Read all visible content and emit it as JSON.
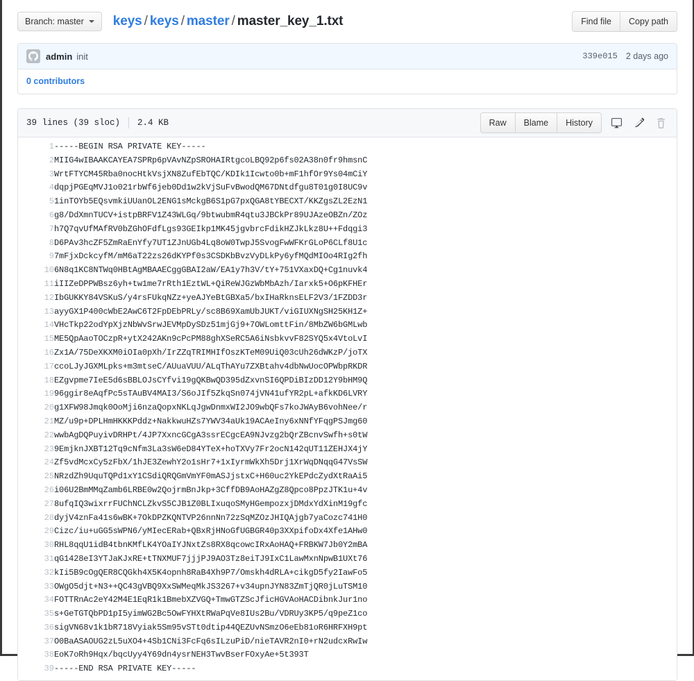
{
  "header": {
    "branch_button": {
      "label": "Branch: master",
      "icon": "chevron-down-icon"
    },
    "breadcrumb": {
      "parts": [
        "keys",
        "keys",
        "master"
      ],
      "separator": "/",
      "filename": "master_key_1.txt"
    },
    "actions": [
      {
        "label": "Find file",
        "name": "find-file-button"
      },
      {
        "label": "Copy path",
        "name": "copy-path-button"
      }
    ]
  },
  "commit": {
    "avatar_icon": "github-mark-icon",
    "author": "admin",
    "message": "init",
    "sha": "339e015",
    "time": "2 days ago",
    "contributors": "0 contributors"
  },
  "file": {
    "lines_text": "39 lines (39 sloc)",
    "size_text": "2.4 KB",
    "buttons": [
      {
        "label": "Raw",
        "name": "raw-button"
      },
      {
        "label": "Blame",
        "name": "blame-button"
      },
      {
        "label": "History",
        "name": "history-button"
      }
    ],
    "icons": [
      {
        "name": "desktop-icon",
        "title": "Open in desktop"
      },
      {
        "name": "pencil-icon",
        "title": "Edit this file"
      },
      {
        "name": "trash-icon",
        "title": "Delete this file"
      }
    ],
    "lines": [
      "-----BEGIN RSA PRIVATE KEY-----",
      "MIIG4wIBAAKCAYEA7SPRp6pVAvNZpSROHAIRtgcoLBQ92p6fs02A38n0fr9hmsnC",
      "WrtFTYCM45Rba0nocHtkVsjXN8ZufEbTQC/KDIk1Icwto0b+mF1hfOr9Ys04mCiY",
      "dqpjPGEqMVJ1o021rbWf6jeb0Dd1w2kVjSuFvBwodQM67DNtdfgu8T01g0I8UC9v",
      "1inTOYb5EQsvmkiUUanOL2ENG1sMckgB6S1pG7pxQGA8tYBECXT/KKZgsZL2EzN1",
      "g8/DdXmnTUCV+istpBRFV1Z43WLGq/9btwubmR4qtu3JBCkPr89UJAzeOBZn/ZOz",
      "h7Q7qvUfMAfRV0bZGhOFdfLgs93GEIkp1MK45jgvbrcFdikHZJkLkz8U++Fdqgi3",
      "D6PAv3hcZF5ZmRaEnYfy7UT1ZJnUGb4Lq8oW0TwpJ5SvogFwWFKrGLoP6CLf8U1c",
      "7mFjxDckcyfM/mM6aT22zs26dKYPf0s3CSDKbBvzVyDLkPy6yfMQdMIOo4RIg2fh",
      "6N8q1KC8NTWq0HBtAgMBAAECggGBAI2aW/EA1y7h3V/tY+751VXaxDQ+Cg1nuvk4",
      "iIIZeDPPWBsz6yh+tw1me7rRth1EztWL+QiReWJGzWbMbAzh/Iarxk5+O6pKFHEr",
      "IbGUKKY84VSKuS/y4rsFUkqNZz+yeAJYeBtGBXa5/bxIHaRknsELF2V3/1FZDD3r",
      "ayyGX1P400cWbE2AwC6T2FpDEbPRLy/sc8B69XamUbJUKT/viGIUXNgSH25KH1Z+",
      "VHcTkp22odYpXjzNbWvSrwJEVMpDySDz51mjGj9+7OWLomttFin/8MbZW6bGMLwb",
      "ME5QpAaoTOCzpR+ytX242AKn9cPcPM88ghXSeRC5A6iNsbkvvF82SYQ5x4VtoLvI",
      "Zx1A/75DeXKXM0iOIa0pXh/IrZZqTRIMHIfOszKTeM09UiQ03cUh26dWKzP/joTX",
      "ccoLJyJGXMLpks+m3mtseC/AUuaVUU/ALqThAYu7ZXBtahv4dbNwUocOPWbpRKDR",
      "EZgvpme7IeE5d6sBBLOJsCYfvi19gQKBwQD395dZxvnSI6QPDiBIzDD12Y9bHM9Q",
      "96ggir8eAqfPc5sTAuBV4MAI3/S6oJIf5ZkqSn074jVN41ufYR2pL+afkKD6LVRY",
      "g1XFW98Jmqk0OoMji6nzaQopxNKLqJgwDnmxWI2JO9wbQFs7koJWAyB6vohNee/r",
      "MZ/u9p+DPLHmHKKKPddz+NakkwuHZs7YWV34aUk19ACAeIny6xNNfYFqgPSJmg60",
      "wwbAgDQPuyivDRHPt/4JP7XxncGCgA3ssrECgcEA9NJvzg2bQrZBcnvSwfh+s0tW",
      "9EmjknJXBT12Tq9cNfm3La3sW6eD84YTeX+hoTXVy7Fr2ocN142qUT11ZEHJX4jY",
      "Zf5vdMcxCy5zFbX/1hJE3ZewhY2o1sHr7+1xIyrmWkXh5Drj1XrWqDNqqG47VsSW",
      "NRzdZh9UquTQPd1xY1CSdiQRQGmVmYF0mASJjstxC+H60uc2YkEPdcZydXtRaAi5",
      "i06U2BmMMqZamb6LRBE0w2QojrmBnJkp+3CffDB9AoHAZgZ8Qpco8PpzJTK1u+4v",
      "8ufqIQ3wixrrFUChNCLZkvS5CJB1Z0BLIxuqoSMyHGempozxjDMdxYdXinM19gfc",
      "dyjV4znFa41s6wBK+7OkDPZKQNTVP26nnNn72zSqMZOzJHIQAjgb7yaCozc741H0",
      "Cizc/iu+uGG5sWPN6/yMIecERab+QBxRjHNoGfUGBGR40p3XXpifoDx4Xfe1AHw0",
      "RHL8qqU1idB4tbnKMfLK4YOaIYJNxtZs8RX8qcowcIRxAoHAQ+FRBKW7Jb0Y2mBA",
      "qG1428eI3YTJaKJxRE+tTNXMUF7jjjPJ9AO3Tz8eiTJ9IxC1LawMxnNpwB1UXt76",
      "kIi5B9cOgQER8CQGkh4X5K4opnh8RaB4Xh9P7/Omskh4dRLA+cikgD5fy2IawFo5",
      "OWgO5djt+N3++QC43gVBQ9XxSWMeqMkJS3267+v34upnJYN83ZmTjQR0jLuTSM10",
      "FOTTRnAc2eY42M4E1EqR1k1BmebXZVGQ+TmwGTZScJficHGVAoHACDibnkJur1no",
      "s+GeTGTQbPD1pI5yimWG2Bc5OwFYHXtRWaPqVe8IUs2Bu/VDRUy3KP5/q9peZ1co",
      "sigVN68v1k1bR718Vyiak5Sm95vSTt0dtip44QEZUvNSmzO6eEb81oR6HRFXH9pt",
      "O0BaASAOUG2zL5uXO4+4Sb1CNi3FcFq6sILzuPiD/nieTAVR2nI0+rN2udcxRwIw",
      "EoK7oRh9Hqx/bqcUyy4Y69dn4ysrNEH3TwvBserFOxyAe+5t393T",
      "-----END RSA PRIVATE KEY-----"
    ]
  },
  "colors": {
    "link": "#2f7de1",
    "commit_bg": "#f1f8ff",
    "file_head_bg": "#f6f8fa",
    "border": "#dfe2e5",
    "line_number": "#b8bfc6"
  }
}
